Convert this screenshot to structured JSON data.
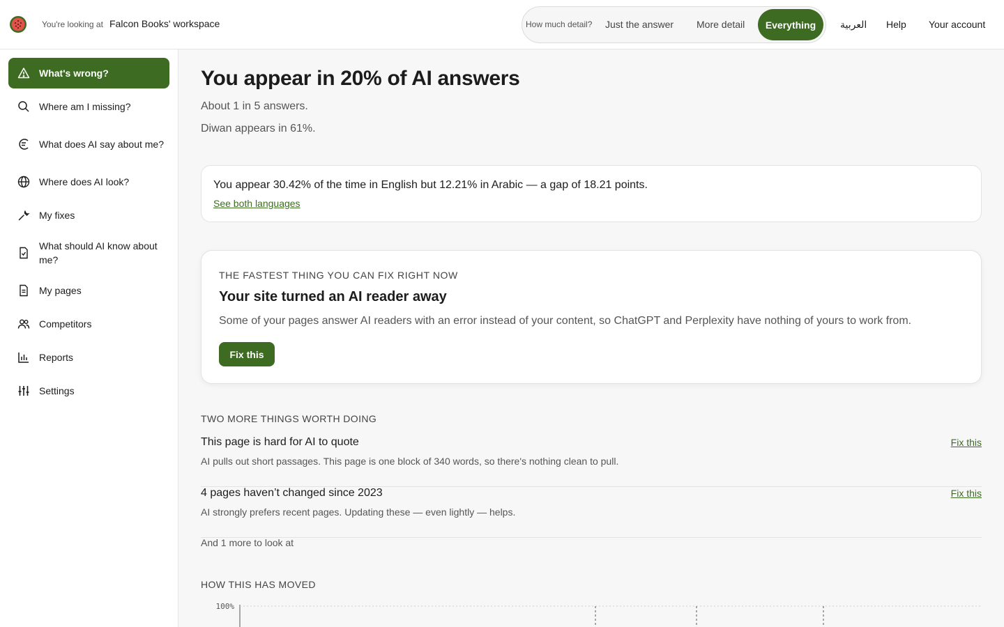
{
  "header": {
    "workspace_prefix": "You're looking at",
    "workspace_name": "Falcon Books' workspace",
    "detail_label": "How much detail?",
    "detail_options": [
      "Just the answer",
      "More detail",
      "Everything"
    ],
    "detail_selected": "Everything",
    "language_link": "العربية",
    "help": "Help",
    "account": "Your account"
  },
  "sidebar": {
    "items": [
      {
        "label": "What's wrong?",
        "icon": "warning-icon",
        "active": true
      },
      {
        "label": "Where am I missing?",
        "icon": "search-icon"
      },
      {
        "label": "What does AI say about me?",
        "icon": "chat-icon"
      },
      {
        "label": "Where does AI look?",
        "icon": "globe-icon"
      },
      {
        "label": "My fixes",
        "icon": "wrench-icon"
      },
      {
        "label": "What should AI know about me?",
        "icon": "doc-check-icon"
      },
      {
        "label": "My pages",
        "icon": "page-icon"
      },
      {
        "label": "Competitors",
        "icon": "people-icon"
      },
      {
        "label": "Reports",
        "icon": "bar-chart-icon"
      },
      {
        "label": "Settings",
        "icon": "sliders-icon"
      }
    ]
  },
  "main": {
    "title": "You appear in 20% of AI answers",
    "subtitle_1": "About 1 in 5 answers.",
    "subtitle_2": "Diwan appears in 61%.",
    "language_card": {
      "text": "You appear 30.42% of the time in English but 12.21% in Arabic — a gap of 18.21 points.",
      "link": "See both languages"
    },
    "fix_card": {
      "eyebrow": "THE FASTEST THING YOU CAN FIX RIGHT NOW",
      "heading": "Your site turned an AI reader away",
      "description": "Some of your pages answer AI readers with an error instead of your content, so ChatGPT and Perplexity have nothing of yours to work from.",
      "button": "Fix this"
    },
    "more_things": {
      "label": "TWO MORE THINGS WORTH DOING",
      "items": [
        {
          "title": "This page is hard for AI to quote",
          "desc": "AI pulls out short passages. This page is one block of 340 words, so there's nothing clean to pull.",
          "action": "Fix this"
        },
        {
          "title": "4 pages haven’t changed since 2023",
          "desc": "AI strongly prefers recent pages. Updating these — even lightly — helps.",
          "action": "Fix this"
        }
      ],
      "more": "And 1 more to look at"
    },
    "history": {
      "label": "HOW THIS HAS MOVED"
    }
  },
  "chart_data": {
    "type": "line",
    "title": "",
    "ytick_labels": [
      "100%"
    ],
    "ylim": [
      0,
      100
    ]
  },
  "colors": {
    "accent": "#3d6b22",
    "background": "#f7f7f7",
    "logo": "#c0392b"
  }
}
